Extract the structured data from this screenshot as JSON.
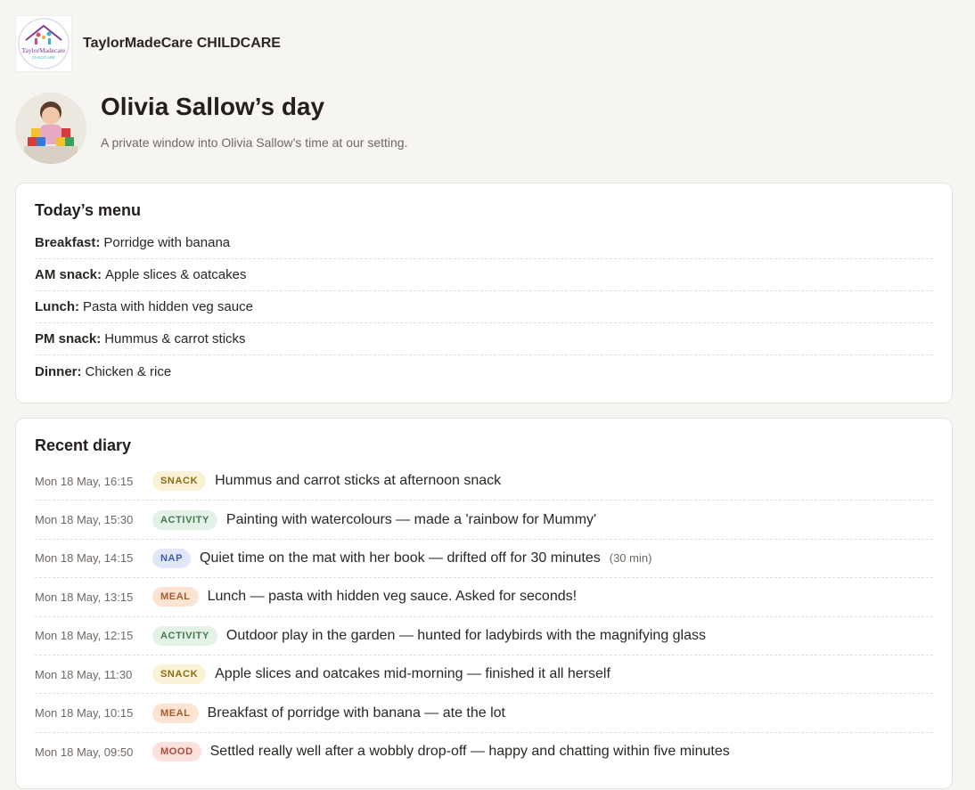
{
  "header": {
    "brand_name": "TaylorMadeCare CHILDCARE",
    "logo_text_main": "TaylorMadecare",
    "logo_text_sub": "CHILDCARE"
  },
  "hero": {
    "title": "Olivia Sallow’s day",
    "subtitle": "A private window into Olivia Sallow’s time at our setting."
  },
  "menu": {
    "title": "Today’s menu",
    "items": [
      {
        "label": "Breakfast:",
        "value": "Porridge with banana"
      },
      {
        "label": "AM snack:",
        "value": "Apple slices & oatcakes"
      },
      {
        "label": "Lunch:",
        "value": "Pasta with hidden veg sauce"
      },
      {
        "label": "PM snack:",
        "value": "Hummus & carrot sticks"
      },
      {
        "label": "Dinner:",
        "value": "Chicken & rice"
      }
    ]
  },
  "diary": {
    "title": "Recent diary",
    "entries": [
      {
        "time": "Mon 18 May, 16:15",
        "tag": "SNACK",
        "text": "Hummus and carrot sticks at afternoon snack",
        "extra": ""
      },
      {
        "time": "Mon 18 May, 15:30",
        "tag": "ACTIVITY",
        "text": "Painting with watercolours — made a 'rainbow for Mummy'",
        "extra": ""
      },
      {
        "time": "Mon 18 May, 14:15",
        "tag": "NAP",
        "text": "Quiet time on the mat with her book — drifted off for 30 minutes",
        "extra": "(30 min)"
      },
      {
        "time": "Mon 18 May, 13:15",
        "tag": "MEAL",
        "text": "Lunch — pasta with hidden veg sauce. Asked for seconds!",
        "extra": ""
      },
      {
        "time": "Mon 18 May, 12:15",
        "tag": "ACTIVITY",
        "text": "Outdoor play in the garden — hunted for ladybirds with the magnifying glass",
        "extra": ""
      },
      {
        "time": "Mon 18 May, 11:30",
        "tag": "SNACK",
        "text": "Apple slices and oatcakes mid-morning — finished it all herself",
        "extra": ""
      },
      {
        "time": "Mon 18 May, 10:15",
        "tag": "MEAL",
        "text": "Breakfast of porridge with banana — ate the lot",
        "extra": ""
      },
      {
        "time": "Mon 18 May, 09:50",
        "tag": "MOOD",
        "text": "Settled really well after a wobbly drop-off — happy and chatting within five minutes",
        "extra": ""
      }
    ]
  },
  "badge_colors": {
    "SNACK": {
      "bg": "#fbf1d6",
      "fg": "#8a6a14"
    },
    "ACTIVITY": {
      "bg": "#e3f1e6",
      "fg": "#3f7a4f"
    },
    "NAP": {
      "bg": "#e1e7f8",
      "fg": "#3d5bb0"
    },
    "MEAL": {
      "bg": "#fce3d2",
      "fg": "#a9582a"
    },
    "MOOD": {
      "bg": "#fbe0dc",
      "fg": "#b0493a"
    }
  }
}
